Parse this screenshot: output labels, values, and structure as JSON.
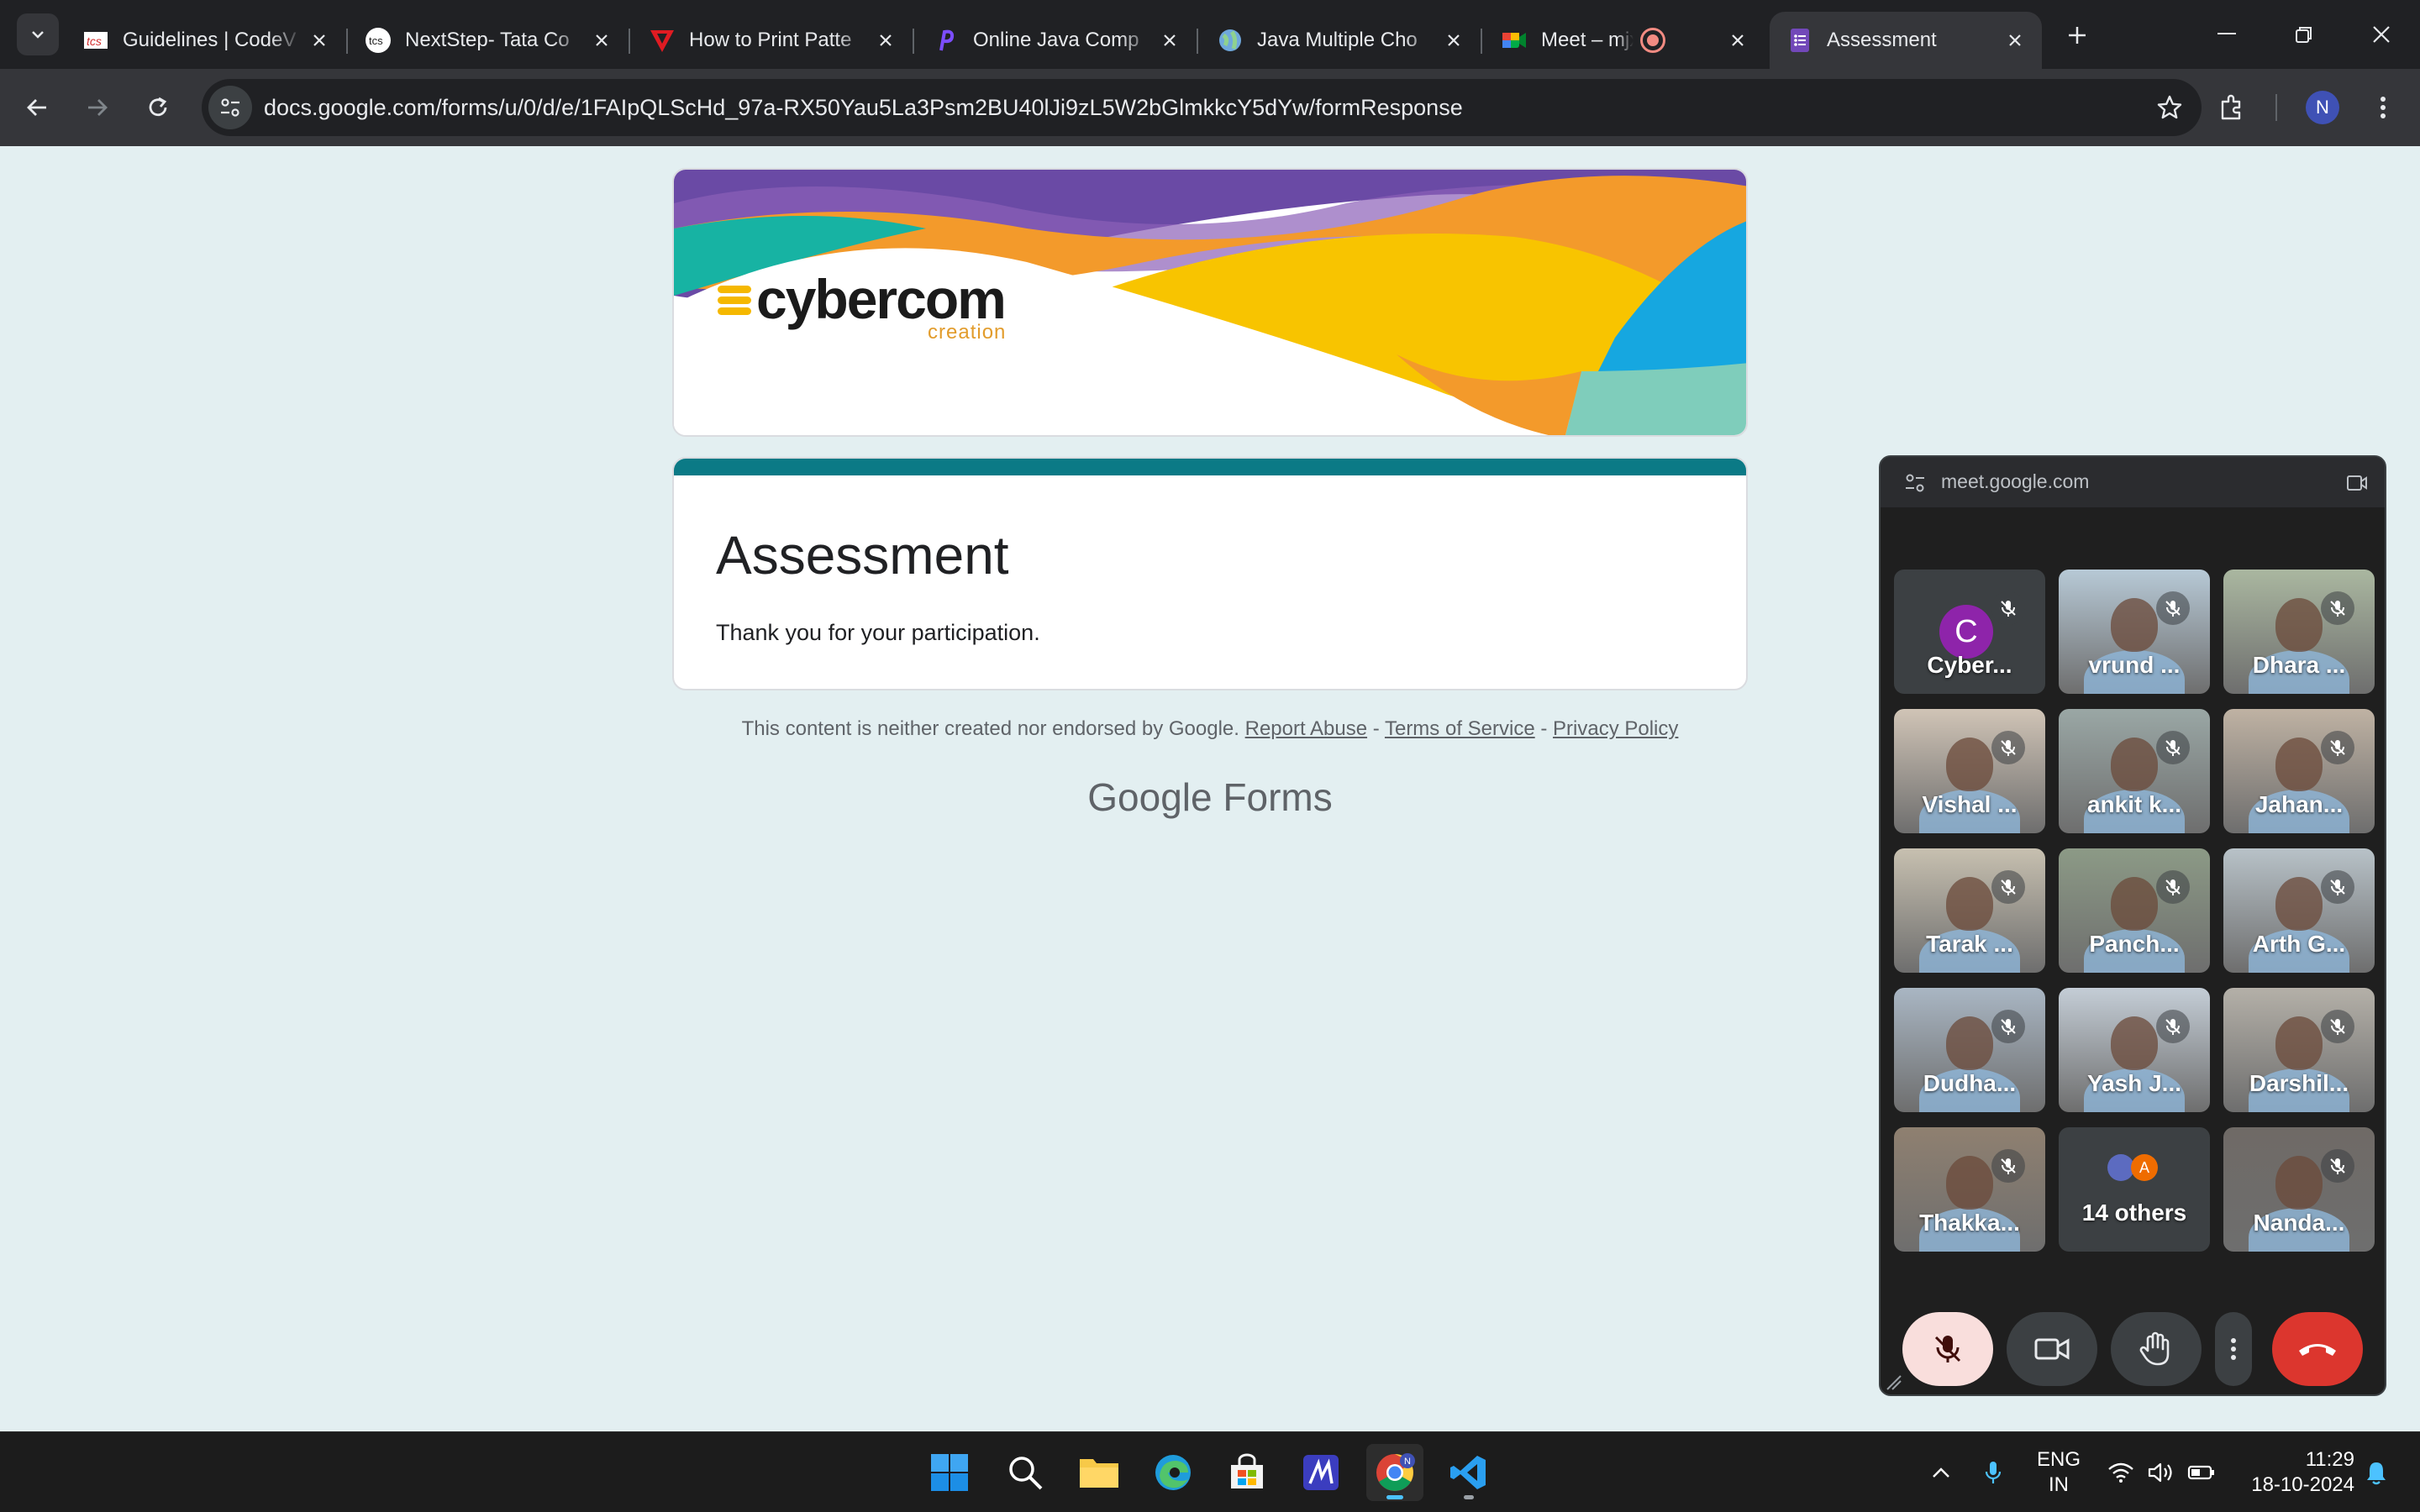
{
  "browser": {
    "tabs": [
      {
        "title": "Guidelines | CodeV",
        "favicon": "tcs-icon",
        "active": false
      },
      {
        "title": "NextStep- Tata Co",
        "favicon": "tcs-circle-icon",
        "active": false
      },
      {
        "title": "How to Print Patte",
        "favicon": "v-logo-icon",
        "active": false
      },
      {
        "title": "Online Java Comp",
        "favicon": "p-logo-icon",
        "active": false
      },
      {
        "title": "Java Multiple Cho",
        "favicon": "globe-icon",
        "active": false
      },
      {
        "title": "Meet – mjx-ot",
        "favicon": "meet-icon",
        "active": false,
        "recording": true
      },
      {
        "title": "Assessment",
        "favicon": "forms-icon",
        "active": true
      }
    ],
    "address": "docs.google.com/forms/u/0/d/e/1FAIpQLScHd_97a-RX50Yau5La3Psm2BU40lJi9zL5W2bGlmkkcY5dYw/formResponse",
    "profile_initial": "N"
  },
  "form": {
    "banner_logo": "cybercom",
    "banner_sub": "creation",
    "title": "Assessment",
    "message": "Thank you for your participation.",
    "footer_text": "This content is neither created nor endorsed by Google.",
    "footer_links": [
      "Report Abuse",
      "Terms of Service",
      "Privacy Policy"
    ],
    "footer_sep": " - ",
    "brand": {
      "google": "Google",
      "forms": "Forms"
    }
  },
  "meet": {
    "url": "meet.google.com",
    "participants": [
      {
        "name": "Cyber...",
        "initial": "C",
        "avatar": true
      },
      {
        "name": "vrund ..."
      },
      {
        "name": "Dhara ..."
      },
      {
        "name": "Vishal ..."
      },
      {
        "name": "ankit k..."
      },
      {
        "name": "Jahan..."
      },
      {
        "name": "Tarak ..."
      },
      {
        "name": "Panch..."
      },
      {
        "name": "Arth G..."
      },
      {
        "name": "Dudha..."
      },
      {
        "name": "Yash J..."
      },
      {
        "name": "Darshil..."
      },
      {
        "name": "Thakka..."
      },
      {
        "name": "14 others",
        "others": true,
        "initial": "A"
      },
      {
        "name": "Nanda..."
      }
    ]
  },
  "taskbar": {
    "lang_top": "ENG",
    "lang_bottom": "IN",
    "time": "11:29",
    "date": "18-10-2024"
  },
  "colors": {
    "form_accent": "#0b7a86",
    "meet_end": "#dc362e",
    "meet_mute": "#f9dedc"
  }
}
